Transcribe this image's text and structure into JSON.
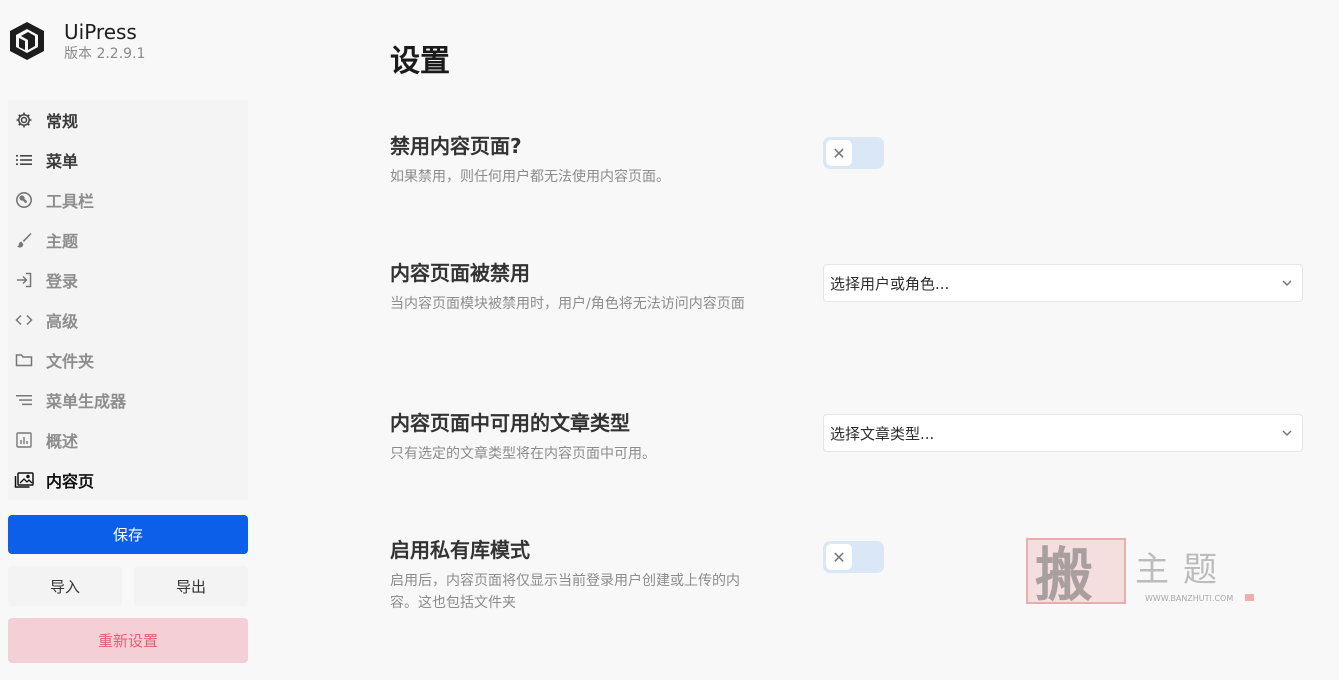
{
  "brand": {
    "name": "UiPress",
    "version": "版本 2.2.9.1"
  },
  "sidebar": {
    "items": [
      {
        "label": "常规",
        "icon": "gear-icon"
      },
      {
        "label": "菜单",
        "icon": "list-icon"
      },
      {
        "label": "工具栏",
        "icon": "wrench-icon"
      },
      {
        "label": "主题",
        "icon": "brush-icon"
      },
      {
        "label": "登录",
        "icon": "login-icon"
      },
      {
        "label": "高级",
        "icon": "code-icon"
      },
      {
        "label": "文件夹",
        "icon": "folder-icon"
      },
      {
        "label": "菜单生成器",
        "icon": "menu-builder-icon"
      },
      {
        "label": "概述",
        "icon": "analytics-icon"
      },
      {
        "label": "内容页",
        "icon": "image-icon"
      }
    ],
    "active_item": "内容页",
    "save_label": "保存",
    "import_label": "导入",
    "export_label": "导出",
    "reset_label": "重新设置"
  },
  "main": {
    "title": "设置",
    "settings": [
      {
        "title": "禁用内容页面?",
        "desc": "如果禁用，则任何用户都无法使用内容页面。",
        "control": "toggle",
        "value": false
      },
      {
        "title": "内容页面被禁用",
        "desc": "当内容页面模块被禁用时，用户/角色将无法访问内容页面",
        "control": "select",
        "value": "选择用户或角色..."
      },
      {
        "title": "内容页面中可用的文章类型",
        "desc": "只有选定的文章类型将在内容页面中可用。",
        "control": "select",
        "value": "选择文章类型..."
      },
      {
        "title": "启用私有库模式",
        "desc": "启用后，内容页面将仅显示当前登录用户创建或上传的内容。这也包括文件夹",
        "control": "toggle",
        "value": false
      }
    ]
  },
  "watermark": {
    "text": "搬主题",
    "url": "WWW.BANZHUTI.COM"
  },
  "colors": {
    "primary": "#0c5fe8",
    "reset_bg": "#f4d0d6",
    "reset_text": "#e26077",
    "toggle_bg": "#d9e7f7"
  }
}
